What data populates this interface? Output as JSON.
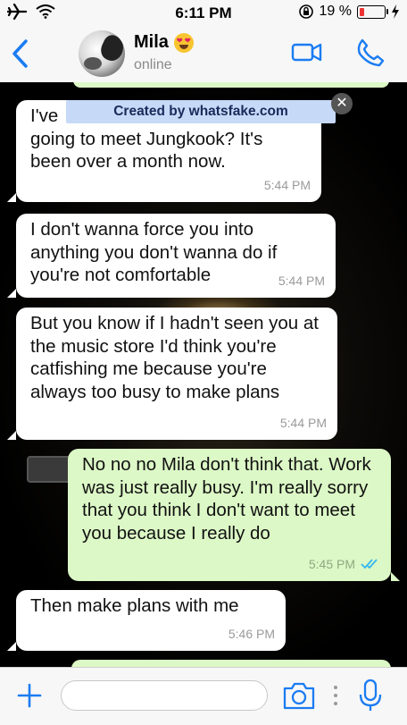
{
  "status_bar": {
    "time": "6:11 PM",
    "battery_percent": "19 %",
    "battery_level": 0.19
  },
  "header": {
    "contact_name": "Mila",
    "contact_status": "online",
    "accent_color": "#1b7cf2"
  },
  "watermark": {
    "text": "Created by whatsfake.com"
  },
  "messages": [
    {
      "direction": "incoming",
      "line1_start": "I've",
      "text_rest": "going to meet Jungkook? It's been over a month now.",
      "time": "5:44 PM"
    },
    {
      "direction": "incoming",
      "text": "I don't wanna force you into anything you don't wanna do if you're not comfortable",
      "time": "5:44 PM"
    },
    {
      "direction": "incoming",
      "text": "But you know if I hadn't seen you at the music store I'd think you're catfishing me because you're always too busy to make plans",
      "time": "5:44 PM"
    },
    {
      "direction": "outgoing",
      "text": "No no no Mila don't think that. Work was just really busy. I'm really sorry that you think I don't want to meet you because I really do",
      "time": "5:45 PM",
      "status": "read"
    },
    {
      "direction": "incoming",
      "text": "Then make plans with me",
      "time": "5:46 PM"
    }
  ],
  "input": {
    "placeholder": ""
  },
  "colors": {
    "incoming_bubble": "#ffffff",
    "outgoing_bubble": "#dcf8c6",
    "read_ticks": "#34b7f1"
  },
  "icons": [
    "airplane-icon",
    "wifi-icon",
    "orientation-lock-icon",
    "battery-icon",
    "charging-icon",
    "back-chevron-icon",
    "video-call-icon",
    "phone-icon",
    "plus-icon",
    "camera-icon",
    "microphone-icon",
    "double-check-icon",
    "close-icon"
  ]
}
